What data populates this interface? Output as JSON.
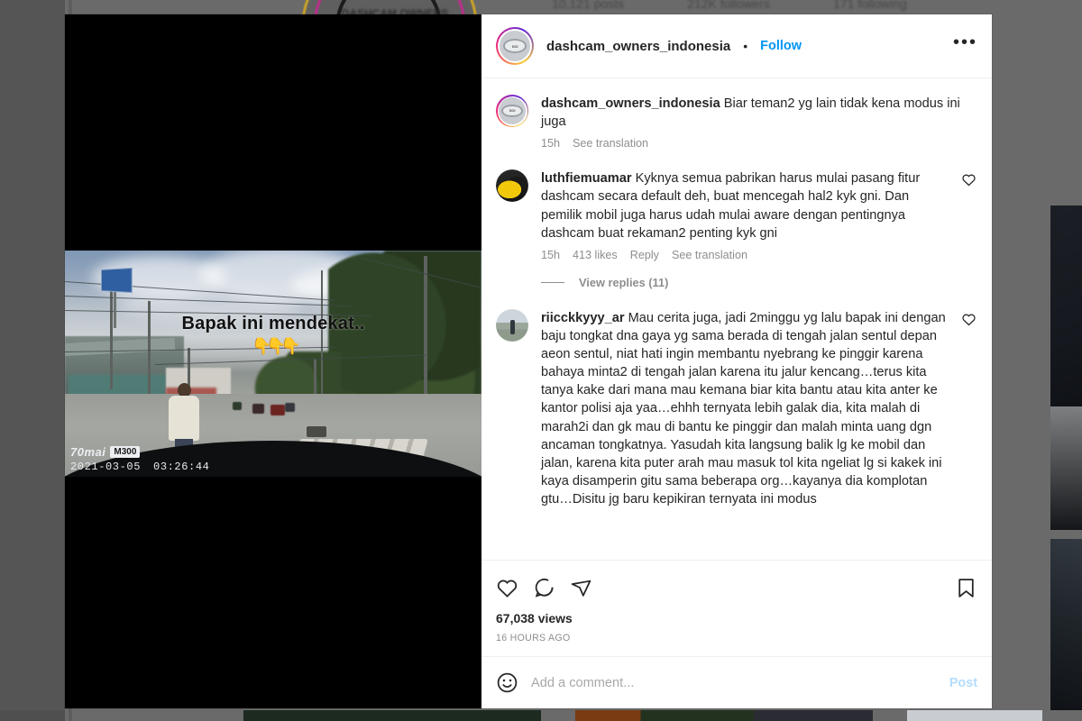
{
  "background": {
    "profile_stats": [
      "10,121 posts",
      "212K followers",
      "171 following"
    ],
    "profile_name": "DASHCAM OWNERS"
  },
  "post": {
    "header": {
      "username": "dashcam_owners_indonesia",
      "separator": "•",
      "follow_label": "Follow",
      "more_label": "•••"
    },
    "video": {
      "caption_overlay": "Bapak ini mendekat..",
      "arrow_glyph": "👇",
      "arrow_count": 3,
      "watermark_brand": "70mai",
      "watermark_model": "M300",
      "watermark_date": "2021-03-05",
      "watermark_time": "03:26:44"
    },
    "caption": {
      "username": "dashcam_owners_indonesia",
      "text": "Biar teman2 yg lain tidak kena modus ini juga",
      "time": "15h",
      "translate_label": "See translation"
    },
    "comments": [
      {
        "username": "luthfiemuamar",
        "text": "Kyknya semua pabrikan harus mulai pasang fitur dashcam secara default deh, buat mencegah hal2 kyk gni. Dan pemilik mobil juga harus udah mulai aware dengan pentingnya dashcam buat rekaman2 penting kyk gni",
        "time": "15h",
        "likes": "413 likes",
        "reply_label": "Reply",
        "translate_label": "See translation",
        "replies_label": "View replies (11)",
        "avatar": "yellow-car"
      },
      {
        "username": "riicckkyyy_ar",
        "text": "Mau cerita juga, jadi 2minggu yg lalu bapak ini dengan baju tongkat dna gaya yg sama berada di tengah jalan sentul depan aeon sentul, niat hati ingin membantu nyebrang ke pinggir karena bahaya minta2 di tengah jalan karena itu jalur kencang…terus kita tanya kake dari mana mau kemana biar kita bantu atau kita anter ke kantor polisi aja yaa…ehhh ternyata lebih galak dia, kita malah di marah2i dan gk mau di bantu ke pinggir dan malah minta uang dgn ancaman tongkatnya. Yasudah kita langsung balik lg ke mobil dan jalan, karena kita puter arah mau masuk tol kita ngeliat lg si kakek ini kaya disamperin gitu sama beberapa org…kayanya dia komplotan gtu…Disitu jg baru kepikiran ternyata ini modus",
        "avatar": "person-outdoors"
      }
    ],
    "actions": {
      "like_icon": "heart-icon",
      "comment_icon": "comment-bubble-icon",
      "share_icon": "share-paper-plane-icon",
      "save_icon": "bookmark-icon"
    },
    "views": "67,038 views",
    "timestamp": "16 HOURS AGO",
    "add_comment": {
      "emoji_icon": "smiley-face-icon",
      "placeholder": "Add a comment...",
      "post_label": "Post"
    }
  },
  "colors": {
    "link_blue": "#0095f6",
    "post_disabled_blue": "#b3dcfe",
    "text_primary": "#262626",
    "text_secondary": "#8e8e8e",
    "arrow_orange": "#e8840f"
  }
}
